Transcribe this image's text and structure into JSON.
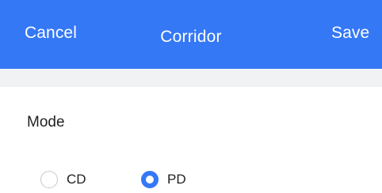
{
  "nav": {
    "cancel_label": "Cancel",
    "title": "Corridor",
    "save_label": "Save",
    "background_color": "#3478f6"
  },
  "form": {
    "mode_label": "Mode",
    "mode_options": [
      {
        "label": "CD",
        "selected": false
      },
      {
        "label": "PD",
        "selected": true
      }
    ]
  },
  "colors": {
    "accent": "#3478f6",
    "section_gap": "#f1f2f4"
  }
}
